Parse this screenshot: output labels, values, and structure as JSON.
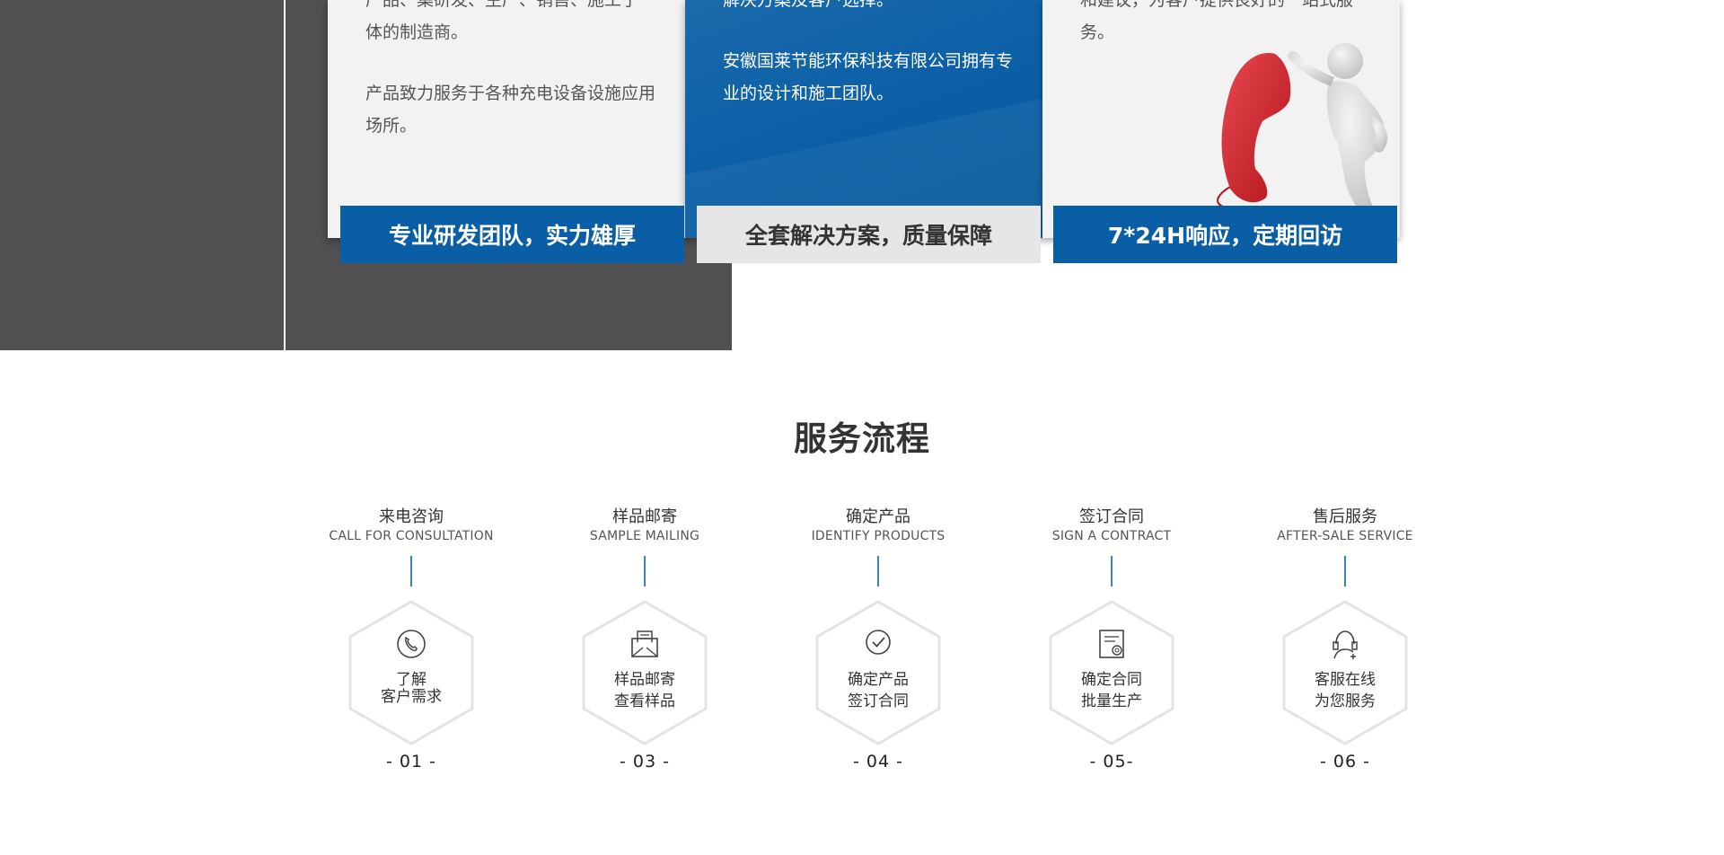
{
  "cards": [
    {
      "paragraphs": [
        "产品、集研发、生产、销售、施工于一体的制造商。",
        "产品致力服务于各种充电设备设施应用场所。"
      ],
      "footer": "专业研发团队，实力雄厚"
    },
    {
      "paragraphs": [
        "解决方案及客户选择。",
        "安徽国莱节能环保科技有限公司拥有专业的设计和施工团队。"
      ],
      "footer": "全套解决方案，质量保障"
    },
    {
      "paragraphs": [
        "和建议，为客户提供良好的一站式服务。"
      ],
      "footer": "7*24H响应，定期回访"
    }
  ],
  "section_title": "服务流程",
  "steps": [
    {
      "title": "来电咨询",
      "subtitle": "CALL FOR CONSULTATION",
      "line1": "了解",
      "line2": "客户需求",
      "num": "- 01 -",
      "icon": "phone-icon"
    },
    {
      "title": "样品邮寄",
      "subtitle": "SAMPLE MAILING",
      "line1": "样品邮寄",
      "line2": "查看样品",
      "num": "- 03 -",
      "icon": "mail-icon"
    },
    {
      "title": "确定产品",
      "subtitle": "IDENTIFY PRODUCTS",
      "line1": "确定产品",
      "line2": "签订合同",
      "num": "- 04 -",
      "icon": "check-icon"
    },
    {
      "title": "签订合同",
      "subtitle": "SIGN A CONTRACT",
      "line1": "确定合同",
      "line2": "批量生产",
      "num": "- 05-",
      "icon": "contract-icon"
    },
    {
      "title": "售后服务",
      "subtitle": "AFTER-SALE SERVICE",
      "line1": "客服在线",
      "line2": "为您服务",
      "num": "- 06 -",
      "icon": "support-icon"
    }
  ],
  "colors": {
    "brand_blue": "#0a5ea6",
    "dark_bg": "#505050",
    "card_bg": "#f2f2f2",
    "step_line": "#3b7fd6"
  }
}
